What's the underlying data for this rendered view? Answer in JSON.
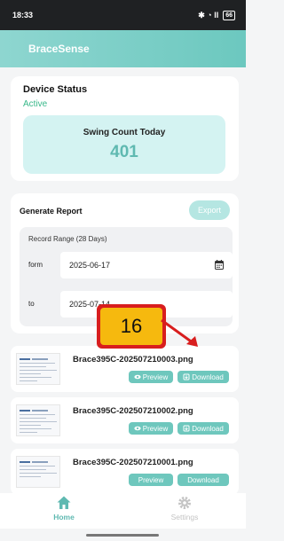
{
  "status_bar": {
    "time": "18:33",
    "signal_text": "✱ ◔ ll",
    "battery": "66"
  },
  "header": {
    "title": "BraceSense"
  },
  "device": {
    "title": "Device Status",
    "status": "Active",
    "swing_label": "Swing Count Today",
    "swing_count": "401"
  },
  "report": {
    "title": "Generate Report",
    "export_label": "Export",
    "range_label": "Record Range (28 Days)",
    "from_label": "form",
    "from_value": "2025-06-17",
    "to_label": "to",
    "to_value": "2025-07-14"
  },
  "files": [
    {
      "name": "Brace395C-202507210003.png",
      "preview": "Preview",
      "download": "Download"
    },
    {
      "name": "Brace395C-202507210002.png",
      "preview": "Preview",
      "download": "Download"
    },
    {
      "name": "Brace395C-202507210001.png",
      "preview": "Preview",
      "download": "Download"
    }
  ],
  "annotation": {
    "label": "16"
  },
  "nav": {
    "home": "Home",
    "settings": "Settings"
  },
  "colors": {
    "accent": "#6ec7bd",
    "header": "#7ccfc7",
    "status_active": "#38b88a",
    "callout_fill": "#f6b90e",
    "callout_border": "#d81e1e"
  }
}
